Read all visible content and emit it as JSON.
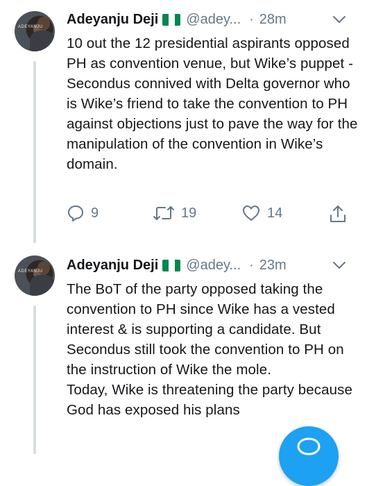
{
  "colors": {
    "accent": "#1da1f2",
    "text": "#14171a",
    "muted": "#657786",
    "thread_line": "#d6dee4"
  },
  "tweets": [
    {
      "author_name": "Adeyanju Deji",
      "author_handle": "@adey...",
      "separator": "·",
      "time": "28m",
      "avatar_text": "ADEYANJU",
      "text": "10 out the 12 presidential aspirants opposed PH as convention venue, but Wike’s puppet -Secondus connived with Delta governor who is Wike’s friend to take the convention to PH against objections just to pave the way for the manipulation of the convention in Wike’s domain.",
      "replies": "9",
      "retweets": "19",
      "likes": "14"
    },
    {
      "author_name": "Adeyanju Deji",
      "author_handle": "@adey...",
      "separator": "·",
      "time": "23m",
      "avatar_text": "ADEYANJU",
      "text": "The BoT of the party opposed taking the convention to PH since Wike has a vested interest & is supporting a candidate. But Secondus still took the convention to PH on the instruction of Wike the mole.\nToday, Wike is threatening the party because God has exposed his plans"
    }
  ],
  "icons": {
    "flag": "nigeria-flag-icon",
    "menu": "chevron-down-icon",
    "reply": "reply-icon",
    "retweet": "retweet-icon",
    "like": "heart-icon",
    "share": "share-icon",
    "compose": "compose-icon"
  }
}
